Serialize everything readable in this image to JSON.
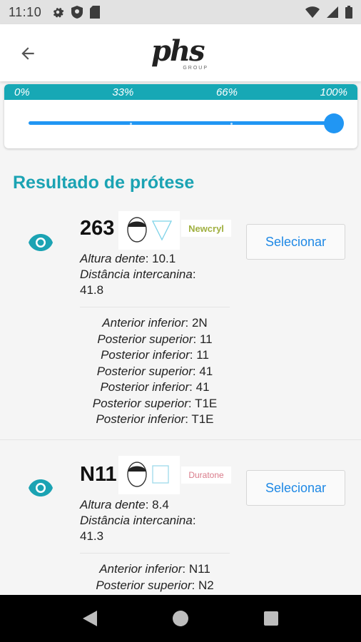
{
  "status_bar": {
    "time": "11:10"
  },
  "header": {
    "logo_text": "phs",
    "logo_sub": "GROUP"
  },
  "progress": {
    "labels": [
      "0%",
      "33%",
      "66%",
      "100%"
    ],
    "value_percent": 100
  },
  "section_title": "Resultado de prótese",
  "results": [
    {
      "code": "263",
      "brand": "Newcryl",
      "select_label": "Selecionar",
      "altura_label": "Altura dente",
      "altura_value": "10.1",
      "dist_label": "Distância intercanina",
      "dist_value": "41.8",
      "positions": [
        {
          "label": "Anterior inferior",
          "value": "2N"
        },
        {
          "label": "Posterior superior",
          "value": "11"
        },
        {
          "label": "Posterior inferior",
          "value": "11"
        },
        {
          "label": "Posterior superior",
          "value": "41"
        },
        {
          "label": "Posterior inferior",
          "value": "41"
        },
        {
          "label": "Posterior superior",
          "value": "T1E"
        },
        {
          "label": "Posterior inferior",
          "value": "T1E"
        }
      ]
    },
    {
      "code": "N11",
      "brand": "Duratone",
      "select_label": "Selecionar",
      "altura_label": "Altura dente",
      "altura_value": "8.4",
      "dist_label": "Distância intercanina",
      "dist_value": "41.3",
      "positions": [
        {
          "label": "Anterior inferior",
          "value": "N11"
        },
        {
          "label": "Posterior superior",
          "value": "N2"
        }
      ]
    }
  ]
}
